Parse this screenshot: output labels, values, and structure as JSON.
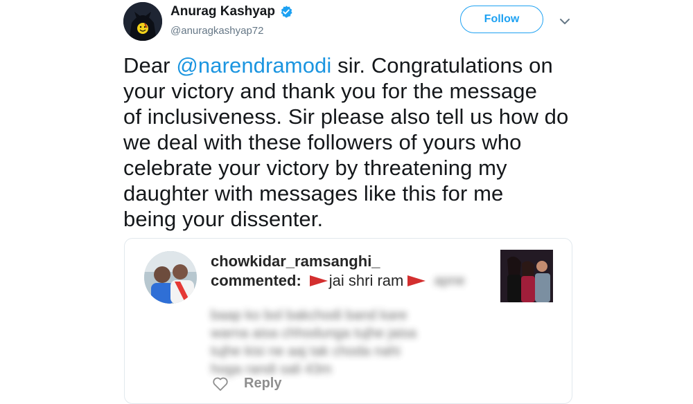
{
  "author": {
    "display_name": "Anurag Kashyap",
    "handle": "@anuragkashyap72",
    "verified": true,
    "avatar_icon": "batman-watchmen-avatar"
  },
  "follow_button": {
    "label": "Follow"
  },
  "menu_icon": "chevron-down-icon",
  "tweet": {
    "lines": [
      {
        "pre": "Dear ",
        "mention": "@narendramodi",
        "post": " sir. Congratulations on"
      },
      {
        "text": "your victory and thank you for the message"
      },
      {
        "text": "of inclusiveness. Sir please also tell us how do"
      },
      {
        "text": "we deal with these followers of yours who"
      },
      {
        "text": "celebrate your victory by threatening my"
      },
      {
        "text": "daughter with messages like this for me"
      },
      {
        "text": "being your dissenter."
      }
    ]
  },
  "embedded": {
    "username": "chowkidar_ramsanghi_",
    "commented_label": "commented:",
    "comment_visible": "jai shri ram",
    "blurred_lines": [
      "apne",
      "baap ko bol bakchodi band kare",
      "warna aisa chhodunga tujhe jaisa",
      "tujhe kisi ne aaj tak choda nahi",
      "hoga randi sali 43m"
    ],
    "reply_label": "Reply",
    "colors": {
      "flag": "#d32f2f",
      "mention": "#1b95e0",
      "follow": "#1da1f2"
    }
  }
}
